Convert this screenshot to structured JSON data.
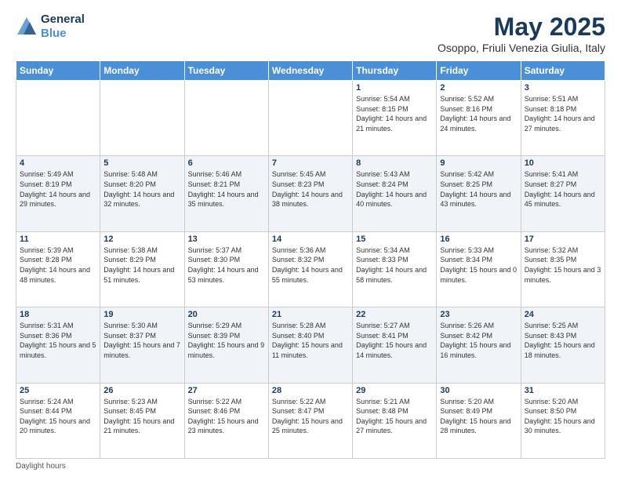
{
  "logo": {
    "line1": "General",
    "line2": "Blue"
  },
  "title": "May 2025",
  "subtitle": "Osoppo, Friuli Venezia Giulia, Italy",
  "days_of_week": [
    "Sunday",
    "Monday",
    "Tuesday",
    "Wednesday",
    "Thursday",
    "Friday",
    "Saturday"
  ],
  "footer": "Daylight hours",
  "weeks": [
    [
      {
        "day": "",
        "info": ""
      },
      {
        "day": "",
        "info": ""
      },
      {
        "day": "",
        "info": ""
      },
      {
        "day": "",
        "info": ""
      },
      {
        "day": "1",
        "info": "Sunrise: 5:54 AM\nSunset: 8:15 PM\nDaylight: 14 hours\nand 21 minutes."
      },
      {
        "day": "2",
        "info": "Sunrise: 5:52 AM\nSunset: 8:16 PM\nDaylight: 14 hours\nand 24 minutes."
      },
      {
        "day": "3",
        "info": "Sunrise: 5:51 AM\nSunset: 8:18 PM\nDaylight: 14 hours\nand 27 minutes."
      }
    ],
    [
      {
        "day": "4",
        "info": "Sunrise: 5:49 AM\nSunset: 8:19 PM\nDaylight: 14 hours\nand 29 minutes."
      },
      {
        "day": "5",
        "info": "Sunrise: 5:48 AM\nSunset: 8:20 PM\nDaylight: 14 hours\nand 32 minutes."
      },
      {
        "day": "6",
        "info": "Sunrise: 5:46 AM\nSunset: 8:21 PM\nDaylight: 14 hours\nand 35 minutes."
      },
      {
        "day": "7",
        "info": "Sunrise: 5:45 AM\nSunset: 8:23 PM\nDaylight: 14 hours\nand 38 minutes."
      },
      {
        "day": "8",
        "info": "Sunrise: 5:43 AM\nSunset: 8:24 PM\nDaylight: 14 hours\nand 40 minutes."
      },
      {
        "day": "9",
        "info": "Sunrise: 5:42 AM\nSunset: 8:25 PM\nDaylight: 14 hours\nand 43 minutes."
      },
      {
        "day": "10",
        "info": "Sunrise: 5:41 AM\nSunset: 8:27 PM\nDaylight: 14 hours\nand 45 minutes."
      }
    ],
    [
      {
        "day": "11",
        "info": "Sunrise: 5:39 AM\nSunset: 8:28 PM\nDaylight: 14 hours\nand 48 minutes."
      },
      {
        "day": "12",
        "info": "Sunrise: 5:38 AM\nSunset: 8:29 PM\nDaylight: 14 hours\nand 51 minutes."
      },
      {
        "day": "13",
        "info": "Sunrise: 5:37 AM\nSunset: 8:30 PM\nDaylight: 14 hours\nand 53 minutes."
      },
      {
        "day": "14",
        "info": "Sunrise: 5:36 AM\nSunset: 8:32 PM\nDaylight: 14 hours\nand 55 minutes."
      },
      {
        "day": "15",
        "info": "Sunrise: 5:34 AM\nSunset: 8:33 PM\nDaylight: 14 hours\nand 58 minutes."
      },
      {
        "day": "16",
        "info": "Sunrise: 5:33 AM\nSunset: 8:34 PM\nDaylight: 15 hours\nand 0 minutes."
      },
      {
        "day": "17",
        "info": "Sunrise: 5:32 AM\nSunset: 8:35 PM\nDaylight: 15 hours\nand 3 minutes."
      }
    ],
    [
      {
        "day": "18",
        "info": "Sunrise: 5:31 AM\nSunset: 8:36 PM\nDaylight: 15 hours\nand 5 minutes."
      },
      {
        "day": "19",
        "info": "Sunrise: 5:30 AM\nSunset: 8:37 PM\nDaylight: 15 hours\nand 7 minutes."
      },
      {
        "day": "20",
        "info": "Sunrise: 5:29 AM\nSunset: 8:39 PM\nDaylight: 15 hours\nand 9 minutes."
      },
      {
        "day": "21",
        "info": "Sunrise: 5:28 AM\nSunset: 8:40 PM\nDaylight: 15 hours\nand 11 minutes."
      },
      {
        "day": "22",
        "info": "Sunrise: 5:27 AM\nSunset: 8:41 PM\nDaylight: 15 hours\nand 14 minutes."
      },
      {
        "day": "23",
        "info": "Sunrise: 5:26 AM\nSunset: 8:42 PM\nDaylight: 15 hours\nand 16 minutes."
      },
      {
        "day": "24",
        "info": "Sunrise: 5:25 AM\nSunset: 8:43 PM\nDaylight: 15 hours\nand 18 minutes."
      }
    ],
    [
      {
        "day": "25",
        "info": "Sunrise: 5:24 AM\nSunset: 8:44 PM\nDaylight: 15 hours\nand 20 minutes."
      },
      {
        "day": "26",
        "info": "Sunrise: 5:23 AM\nSunset: 8:45 PM\nDaylight: 15 hours\nand 21 minutes."
      },
      {
        "day": "27",
        "info": "Sunrise: 5:22 AM\nSunset: 8:46 PM\nDaylight: 15 hours\nand 23 minutes."
      },
      {
        "day": "28",
        "info": "Sunrise: 5:22 AM\nSunset: 8:47 PM\nDaylight: 15 hours\nand 25 minutes."
      },
      {
        "day": "29",
        "info": "Sunrise: 5:21 AM\nSunset: 8:48 PM\nDaylight: 15 hours\nand 27 minutes."
      },
      {
        "day": "30",
        "info": "Sunrise: 5:20 AM\nSunset: 8:49 PM\nDaylight: 15 hours\nand 28 minutes."
      },
      {
        "day": "31",
        "info": "Sunrise: 5:20 AM\nSunset: 8:50 PM\nDaylight: 15 hours\nand 30 minutes."
      }
    ]
  ]
}
